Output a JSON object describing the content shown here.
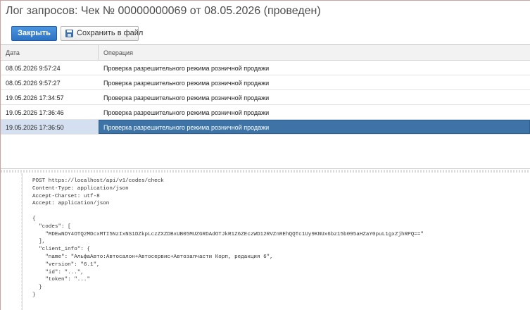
{
  "window": {
    "title": "Лог запросов: Чек № 00000000069 от 08.05.2026 (проведен)"
  },
  "toolbar": {
    "close_label": "Закрыть",
    "save_label": "Сохранить в файл",
    "save_icon": "floppy-disk-icon"
  },
  "table": {
    "columns": [
      "Дата",
      "Операция"
    ],
    "rows": [
      {
        "date": "08.05.2026 9:57:24",
        "operation": "Проверка разрешительного режима розничной продажи"
      },
      {
        "date": "08.05.2026 9:57:27",
        "operation": "Проверка разрешительного режима розничной продажи"
      },
      {
        "date": "19.05.2026 17:34:57",
        "operation": "Проверка разрешительного режима розничной продажи"
      },
      {
        "date": "19.05.2026 17:36:46",
        "operation": "Проверка разрешительного режима розничной продажи"
      },
      {
        "date": "19.05.2026 17:36:50",
        "operation": "Проверка разрешительного режима розничной продажи"
      }
    ],
    "selected_index": 4
  },
  "colors": {
    "accent": "#2d74c4",
    "selection": "#3d74a5"
  },
  "request": {
    "lines": [
      "POST https://localhost/api/v1/codes/check",
      "Content-Type: application/json",
      "Accept-Charset: utf-8",
      "Accept: application/json",
      "",
      "{",
      "  \"codes\": [",
      "    \"MDEwNDY4OTQ2MDcxMTI5NzIxNS1DZkpLczZXZDBxUB05MUZGRDAdOTJkR1Z6ZEczWD12RVZnREhQQTc1Uy9KNUx6bz15b095aHZaY0puL1gxZjhRPQ==\"",
      "  ],",
      "  \"client_info\": {",
      "    \"name\": \"АльфаАвто:Автосалон+Автосервис+Автозапчасти Корп, редакция 6\",",
      "    \"version\": \"6.1\",",
      "    \"id\": \"...\",",
      "    \"token\": \"...\"",
      "  }",
      "}"
    ]
  }
}
